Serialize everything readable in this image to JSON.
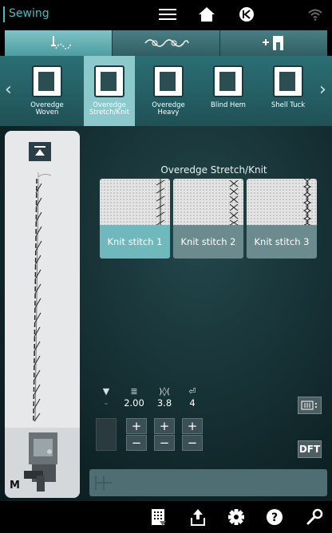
{
  "app": {
    "title": "Sewing"
  },
  "mode_tabs": [
    {
      "id": "sewing-mode",
      "active": true
    },
    {
      "id": "embroidery-mode",
      "active": false
    },
    {
      "id": "add-stitch-mode",
      "active": false
    }
  ],
  "stitch_menu": {
    "items": [
      {
        "label": "Overedge Woven",
        "line1": "Overedge",
        "line2": "Woven",
        "selected": false
      },
      {
        "label": "Overedge Stretch/Knit",
        "line1": "Overedge",
        "line2": "Stretch/Knit",
        "selected": true
      },
      {
        "label": "Overedge Heavy",
        "line1": "Overedge",
        "line2": "Heavy",
        "selected": false
      },
      {
        "label": "Blind Hem",
        "line1": "Blind Hem",
        "line2": "",
        "selected": false
      },
      {
        "label": "Shell Tuck",
        "line1": "Shell Tuck",
        "line2": "",
        "selected": false
      }
    ]
  },
  "main": {
    "heading": "Overedge Stretch/Knit",
    "cards": [
      {
        "label": "Knit stitch 1",
        "selected": true
      },
      {
        "label": "Knit stitch 2",
        "selected": false
      },
      {
        "label": "Knit stitch 3",
        "selected": false
      }
    ]
  },
  "params": {
    "tension": {
      "icon": "tension-icon",
      "value": "-"
    },
    "stitch_length": {
      "icon": "stitch-length-icon",
      "value": "2.00"
    },
    "stitch_width": {
      "icon": "stitch-width-icon",
      "value": "3.8"
    },
    "presser_foot": {
      "icon": "presser-foot-icon",
      "value": "4"
    }
  },
  "side": {
    "dft_label": "DFT"
  },
  "preview": {
    "foot_label": "M"
  },
  "colors": {
    "accent": "#35c3c8",
    "selected": "#8cc9cc"
  }
}
